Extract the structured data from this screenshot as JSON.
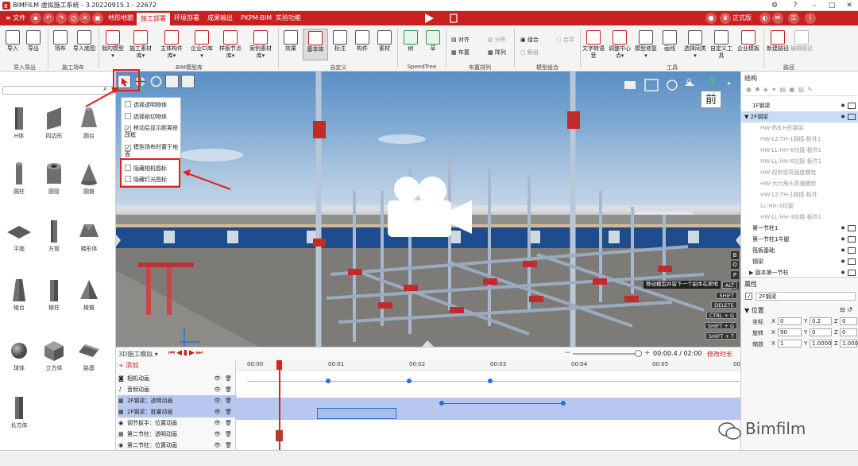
{
  "app": {
    "title": "BIMFILM 虚拟施工系统 - 3.20220915.1 - 22672"
  },
  "menubar": {
    "file_label": "文件",
    "tabs": [
      {
        "label": "地形地貌"
      },
      {
        "label": "施工部署"
      },
      {
        "label": "环境部署"
      },
      {
        "label": "成果输出"
      },
      {
        "label": "PKPM-BIM"
      },
      {
        "label": "实验功能"
      }
    ],
    "edition_badge": "正式版"
  },
  "ribbon": {
    "buttons": [
      {
        "label": "导入"
      },
      {
        "label": "导出"
      },
      {
        "label": "场布"
      },
      {
        "label": "导入底图"
      },
      {
        "label": "我的模型▾"
      },
      {
        "label": "施工素材库▾"
      },
      {
        "label": "主体构件库▾"
      },
      {
        "label": "企业CI库▾"
      },
      {
        "label": "样板节点库▾"
      },
      {
        "label": "案例素材库▾"
      },
      {
        "label": "效果"
      },
      {
        "label": "基本体"
      },
      {
        "label": "标注"
      },
      {
        "label": "构件"
      },
      {
        "label": "素材"
      },
      {
        "label": "树"
      },
      {
        "label": "草"
      },
      {
        "label": "文字转语音"
      },
      {
        "label": "调整中心点▾"
      },
      {
        "label": "模型修复▾"
      },
      {
        "label": "画线"
      },
      {
        "label": "选择同类▾"
      },
      {
        "label": "自定义工具"
      },
      {
        "label": "企业模板"
      },
      {
        "label": "新建路径"
      },
      {
        "label": "编辑路径"
      }
    ],
    "small_buttons": {
      "align": "对齐",
      "distribute": "分布",
      "layout": "布置",
      "array": "阵列",
      "combine": "组合",
      "merge": "合并",
      "uncombine": "解组"
    },
    "groups": [
      {
        "label": "导入导出"
      },
      {
        "label": "施工场布"
      },
      {
        "label": "BIM模型库"
      },
      {
        "label": "自定义"
      },
      {
        "label": "SpeedTree"
      },
      {
        "label": "布置排列"
      },
      {
        "label": "模型组合"
      },
      {
        "label": "工具"
      },
      {
        "label": "路径"
      }
    ]
  },
  "left_panel": {
    "search_placeholder": "",
    "shapes": [
      {
        "label": "H体"
      },
      {
        "label": "四边形"
      },
      {
        "label": "圆台"
      },
      {
        "label": "圆柱"
      },
      {
        "label": "圆管"
      },
      {
        "label": "圆锥"
      },
      {
        "label": "平面"
      },
      {
        "label": "方管"
      },
      {
        "label": "梯形体"
      },
      {
        "label": "棱台"
      },
      {
        "label": "棱柱"
      },
      {
        "label": "棱锥"
      },
      {
        "label": "球体"
      },
      {
        "label": "立方体"
      },
      {
        "label": "路基"
      },
      {
        "label": "长方体"
      }
    ]
  },
  "viewport": {
    "menu_items": [
      {
        "label": "选择透明物体",
        "checked": false
      },
      {
        "label": "选择剖切物体",
        "checked": false
      },
      {
        "label": "移动后显示距离修改框",
        "checked": true
      },
      {
        "label": "模型场布时置于地面",
        "checked": true
      },
      {
        "label": "隐藏相机图标",
        "checked": false
      },
      {
        "label": "隐藏灯光图标",
        "checked": false
      }
    ],
    "view_label": "前",
    "axis_y": "y",
    "hint": "移动模型并留下一个副本在原地",
    "hotkeys": [
      "ALT",
      "SHIFT",
      "DELETE",
      "CTRL + G",
      "SHIFT + G",
      "SHIFT + T"
    ],
    "side_letters": [
      "B",
      "O",
      "P",
      "C"
    ]
  },
  "timeline": {
    "mode_label": "3D施工模拟 ▾",
    "add_label": "添加",
    "time_display": "00:00.4  /  02:00",
    "modify_label": "修改时长",
    "ticks": [
      "00:00",
      "00:01",
      "00:02",
      "00:03",
      "00:04",
      "00:05",
      "00:06"
    ],
    "tracks": [
      {
        "label": "相机动画"
      },
      {
        "label": "音频动画"
      },
      {
        "label": "2F钢梁：透明动画"
      },
      {
        "label": "2F钢梁：批量动画"
      },
      {
        "label": "调节扳手：位置动画"
      },
      {
        "label": "第二节柱：透明动画"
      },
      {
        "label": "第二节柱：位置动画"
      }
    ],
    "track_keys": [
      {
        "track": 0,
        "times": [
          1.0,
          2.0,
          3.0
        ]
      },
      {
        "track": 2,
        "times": [
          2.4,
          3.9
        ]
      }
    ],
    "playhead_time": 0.4
  },
  "right_panel": {
    "structure_title": "结构",
    "tree": [
      {
        "label": "1F钢梁",
        "selected": false
      },
      {
        "label": "2F钢梁",
        "selected": true
      },
      {
        "label": "HW-热轧H形钢梁",
        "selected": false
      },
      {
        "label": "HW-LZ-TH-1刚接-板件1",
        "selected": false
      },
      {
        "label": "HW-LL-HH-6铰接-板件1",
        "selected": false
      },
      {
        "label": "HW-LL-HH-6铰接-板件1",
        "selected": false
      },
      {
        "label": "HW-扭剪型高强度螺栓",
        "selected": false
      },
      {
        "label": "HW-大六角头高强螺栓",
        "selected": false
      },
      {
        "label": "HW-LZ-TH-1刚接-板件",
        "selected": false
      },
      {
        "label": "LL-HH-3铰接",
        "selected": false
      },
      {
        "label": "HW-LL-HH-3铰接-板件1",
        "selected": false
      },
      {
        "label": "第一节柱1",
        "selected": false
      },
      {
        "label": "第一节柱1牛腿",
        "selected": false
      },
      {
        "label": "筏板基础",
        "selected": false
      },
      {
        "label": "钢梁",
        "selected": false
      },
      {
        "label": "▶ 副本第一节柱",
        "selected": false
      }
    ],
    "properties_title": "属性",
    "object_name": "2F钢梁",
    "position_title": "位置",
    "transform": [
      {
        "label": "坐标",
        "x": "0",
        "y": "0.2",
        "z": "0"
      },
      {
        "label": "旋转",
        "x": "90",
        "y": "0",
        "z": "0"
      },
      {
        "label": "缩放",
        "x": "1",
        "y": "1.0000",
        "z": "1.0000"
      }
    ]
  },
  "watermark": "Bimfilm",
  "colors": {
    "brand_red": "#c8201e",
    "selection_blue": "#c9dcf4",
    "key_blue": "#2a6fd8",
    "annotation_red": "#e02020"
  }
}
